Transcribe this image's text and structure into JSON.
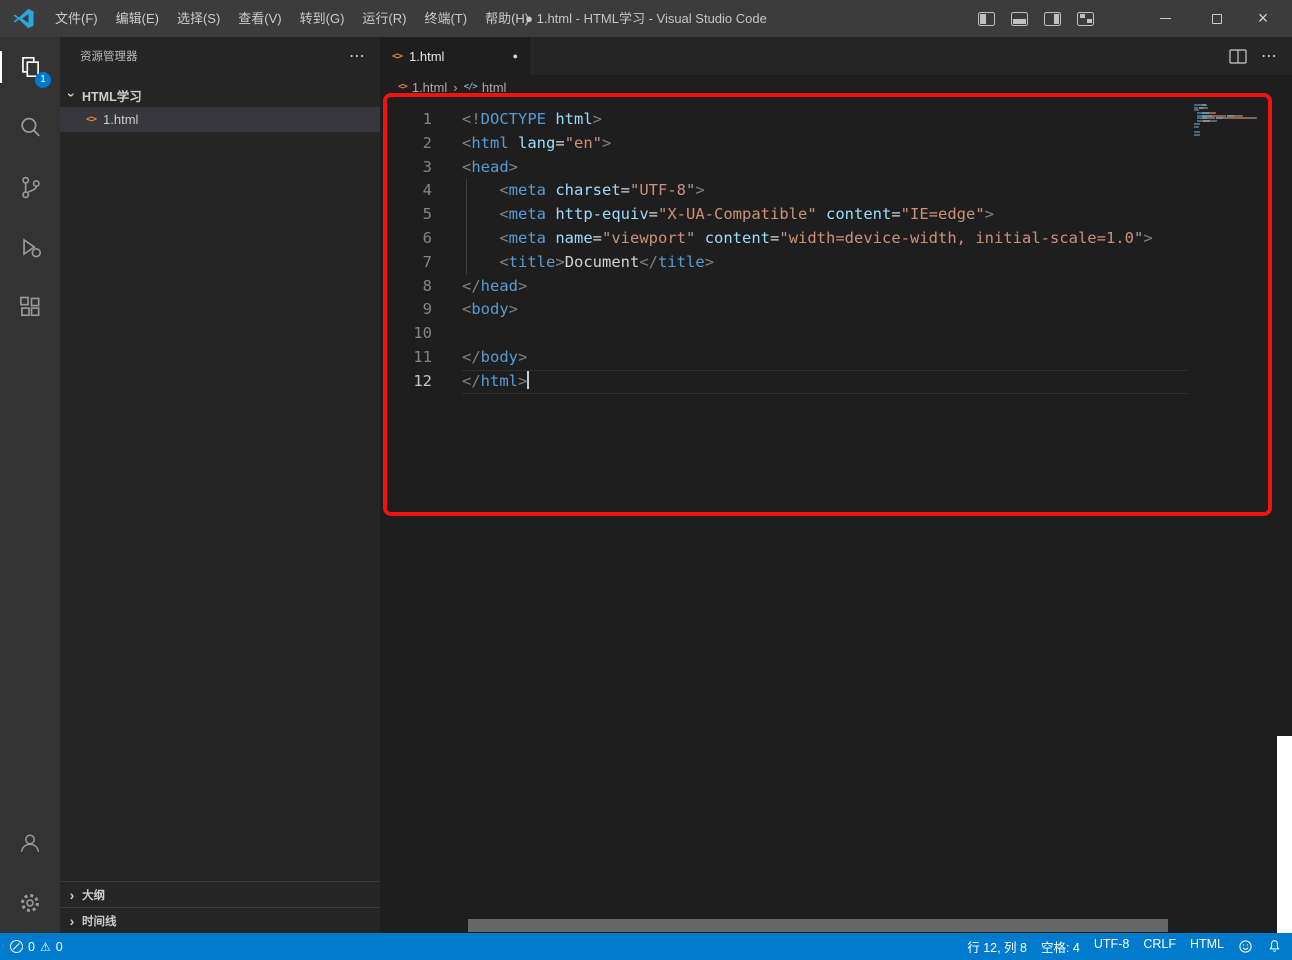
{
  "colors": {
    "accent": "#007acc",
    "annotation": "#ee1410",
    "tag": "#569cd6",
    "attr": "#9cdcfe",
    "str": "#ce9178",
    "punct": "#808080",
    "fg": "#d4d4d4"
  },
  "icons": {
    "more": "⋯",
    "chevron": "›",
    "breadcrumb_sep": "›",
    "html_file": "<>",
    "symbol": "</>",
    "modified_dot": "●",
    "warning": "⚠",
    "close": "×"
  },
  "title_bar": {
    "menus": [
      "文件(F)",
      "编辑(E)",
      "选择(S)",
      "查看(V)",
      "转到(G)",
      "运行(R)",
      "终端(T)",
      "帮助(H)"
    ],
    "title": "● 1.html - HTML学习 - Visual Studio Code"
  },
  "activity_bar": {
    "badge": "1"
  },
  "sidebar": {
    "header": "资源管理器",
    "section": "HTML学习",
    "file": "1.html",
    "bottom_sections": [
      "大纲",
      "时间线"
    ]
  },
  "editor": {
    "tab": "1.html",
    "breadcrumbs": [
      "1.html",
      "html"
    ],
    "lines": [
      {
        "n": "1",
        "tokens": [
          [
            "<!",
            "p"
          ],
          [
            "DOCTYPE",
            "t"
          ],
          [
            " html",
            "a"
          ],
          [
            ">",
            "p"
          ]
        ]
      },
      {
        "n": "2",
        "tokens": [
          [
            "<",
            "p"
          ],
          [
            "html",
            "t"
          ],
          [
            " ",
            "d"
          ],
          [
            "lang",
            "a"
          ],
          [
            "=",
            "d"
          ],
          [
            "\"en\"",
            "s"
          ],
          [
            ">",
            "p"
          ]
        ]
      },
      {
        "n": "3",
        "tokens": [
          [
            "<",
            "p"
          ],
          [
            "head",
            "t"
          ],
          [
            ">",
            "p"
          ]
        ]
      },
      {
        "n": "4",
        "guide": true,
        "tokens": [
          [
            "    ",
            "d"
          ],
          [
            "<",
            "p"
          ],
          [
            "meta",
            "t"
          ],
          [
            " ",
            "d"
          ],
          [
            "charset",
            "a"
          ],
          [
            "=",
            "d"
          ],
          [
            "\"UTF-8\"",
            "s"
          ],
          [
            ">",
            "p"
          ]
        ]
      },
      {
        "n": "5",
        "guide": true,
        "tokens": [
          [
            "    ",
            "d"
          ],
          [
            "<",
            "p"
          ],
          [
            "meta",
            "t"
          ],
          [
            " ",
            "d"
          ],
          [
            "http-equiv",
            "a"
          ],
          [
            "=",
            "d"
          ],
          [
            "\"X-UA-Compatible\"",
            "s"
          ],
          [
            " ",
            "d"
          ],
          [
            "content",
            "a"
          ],
          [
            "=",
            "d"
          ],
          [
            "\"IE=edge\"",
            "s"
          ],
          [
            ">",
            "p"
          ]
        ]
      },
      {
        "n": "6",
        "guide": true,
        "tokens": [
          [
            "    ",
            "d"
          ],
          [
            "<",
            "p"
          ],
          [
            "meta",
            "t"
          ],
          [
            " ",
            "d"
          ],
          [
            "name",
            "a"
          ],
          [
            "=",
            "d"
          ],
          [
            "\"viewport\"",
            "s"
          ],
          [
            " ",
            "d"
          ],
          [
            "content",
            "a"
          ],
          [
            "=",
            "d"
          ],
          [
            "\"width=device-width, initial-scale=1.0\"",
            "s"
          ],
          [
            ">",
            "p"
          ]
        ]
      },
      {
        "n": "7",
        "guide": true,
        "tokens": [
          [
            "    ",
            "d"
          ],
          [
            "<",
            "p"
          ],
          [
            "title",
            "t"
          ],
          [
            ">",
            "p"
          ],
          [
            "Document",
            "d"
          ],
          [
            "</",
            "p"
          ],
          [
            "title",
            "t"
          ],
          [
            ">",
            "p"
          ]
        ]
      },
      {
        "n": "8",
        "tokens": [
          [
            "</",
            "p"
          ],
          [
            "head",
            "t"
          ],
          [
            ">",
            "p"
          ]
        ]
      },
      {
        "n": "9",
        "tokens": [
          [
            "<",
            "p"
          ],
          [
            "body",
            "t"
          ],
          [
            ">",
            "p"
          ]
        ]
      },
      {
        "n": "10",
        "tokens": []
      },
      {
        "n": "11",
        "tokens": [
          [
            "</",
            "p"
          ],
          [
            "body",
            "t"
          ],
          [
            ">",
            "p"
          ]
        ]
      },
      {
        "n": "12",
        "active": true,
        "cursor": true,
        "tokens": [
          [
            "</",
            "p"
          ],
          [
            "html",
            "t"
          ],
          [
            ">",
            "p"
          ]
        ]
      }
    ]
  },
  "status_bar": {
    "errors": "0",
    "warnings": "0",
    "items": [
      "行 12, 列 8",
      "空格: 4",
      "UTF-8",
      "CRLF",
      "HTML"
    ]
  }
}
